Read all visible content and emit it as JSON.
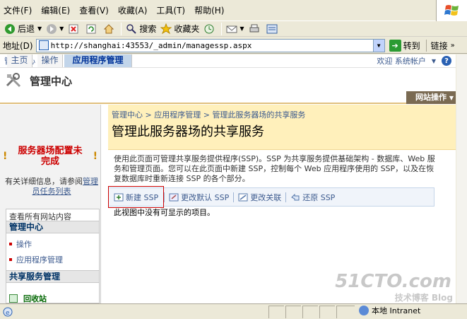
{
  "menu": {
    "items": [
      "文件(F)",
      "编辑(E)",
      "查看(V)",
      "收藏(A)",
      "工具(T)",
      "帮助(H)"
    ]
  },
  "toolbar": {
    "back": "后退",
    "search": "搜索",
    "favorites": "收藏夹"
  },
  "address": {
    "label": "地址(D)",
    "url": "http://shanghai:43553/_admin/managessp.aspx",
    "go": "转到",
    "links": "链接"
  },
  "sp": {
    "top_left": "管理中心",
    "welcome": "欢迎 系统帐户",
    "site_title": "管理中心",
    "tabs": [
      "主页",
      "操作",
      "应用程序管理"
    ],
    "site_actions": "网站操作"
  },
  "title_area": {
    "breadcrumb": [
      "管理中心",
      "应用程序管理",
      "管理此服务器场的共享服务"
    ],
    "title": "管理此服务器场的共享服务"
  },
  "left_nav": {
    "warning": "服务器场配置未完成",
    "detail_prefix": "有关详细信息，请参阅",
    "detail_link": "管理员任务列表",
    "view_all": "查看所有网站内容",
    "section1": "管理中心",
    "items": [
      "操作",
      "应用程序管理"
    ],
    "section2": "共享服务管理",
    "recycle": "回收站"
  },
  "content": {
    "description": "使用此页面可管理共享服务提供程序(SSP)。SSP 为共享服务提供基础架构 - 数据库、Web 服务和管理页面。您可以在此页面中新建 SSP，控制每个 Web 应用程序使用的 SSP，以及在恢复数据库时重新连接 SSP 的各个部分。",
    "actions": [
      "新建 SSP",
      "更改默认 SSP",
      "更改关联",
      "还原 SSP"
    ],
    "empty_text": "此视图中没有可显示的项目。"
  },
  "status": {
    "zone": "本地 Intranet"
  },
  "watermark": {
    "line1": "51CTO.com",
    "line2": "技术博客  Blog"
  }
}
